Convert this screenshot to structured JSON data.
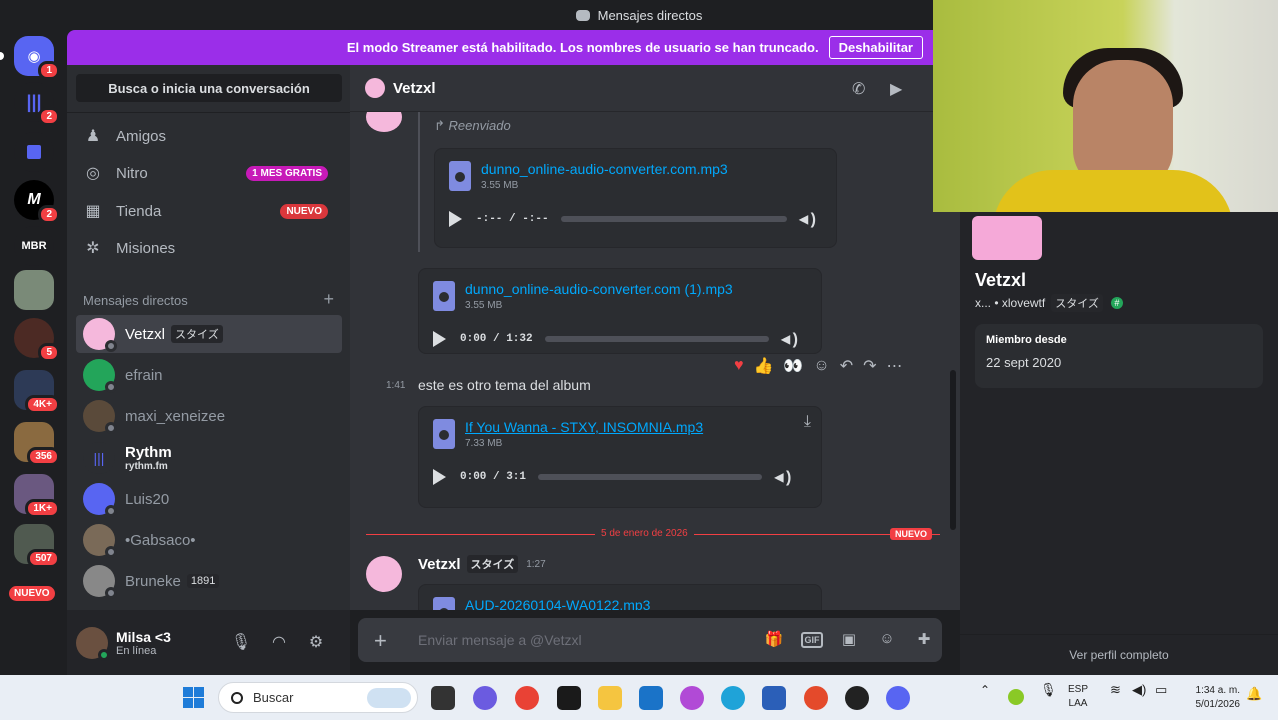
{
  "titlebar": {
    "title": "Mensajes directos"
  },
  "rail": {
    "badges": [
      "1",
      "2",
      "2",
      "5",
      "4K+",
      "356",
      "1K+",
      "507"
    ],
    "mbr_label": "MBR",
    "nuevo": "NUEVO"
  },
  "banner": {
    "text": "El modo Streamer está habilitado. Los nombres de usuario se han truncado.",
    "button": "Deshabilitar"
  },
  "sidebar": {
    "search": "Busca o inicia una conversación",
    "nav": [
      {
        "label": "Amigos"
      },
      {
        "label": "Nitro",
        "tag": "1 MES GRATIS"
      },
      {
        "label": "Tienda",
        "tag": "NUEVO"
      },
      {
        "label": "Misiones"
      }
    ],
    "dm_header": "Mensajes directos",
    "dms": [
      {
        "name": "Vetzxl",
        "tag": "スタイズ"
      },
      {
        "name": "efrain"
      },
      {
        "name": "maxi_xeneizee"
      },
      {
        "name": "Rythm",
        "sub": "rythm.fm"
      },
      {
        "name": "Luis20"
      },
      {
        "name": "•Gabsaco•"
      },
      {
        "name": "Bruneke",
        "tag": "1891"
      }
    ]
  },
  "user": {
    "name": "Milsa <3",
    "status": "En línea"
  },
  "chat": {
    "header": "Vetzxl",
    "forwarded": "Reenviado",
    "attachments": [
      {
        "name": "dunno_online-audio-converter.com.mp3",
        "size": "3.55 MB",
        "time": "-:-- / -:--",
        "progress": 0
      },
      {
        "name": "dunno_online-audio-converter.com (1).mp3",
        "size": "3.55 MB",
        "time": "0:00 / 1:32",
        "progress": 0
      },
      {
        "name": "If You Wanna - STXY, INSOMNIA.mp3",
        "size": "7.33 MB",
        "time": "0:00 / 3:1",
        "progress": 0
      }
    ],
    "message_time": "1:41",
    "message_text": "este es otro tema del album",
    "divider_date": "5 de enero de 2026",
    "new_tag": "NUEVO",
    "next_author": "Vetzxl",
    "next_author_tag": "スタイズ",
    "next_time": "1:27",
    "next_file": "AUD-20260104-WA0122.mp3",
    "composer_placeholder": "Enviar mensaje a @Vetzxl",
    "gif": "GIF"
  },
  "profile": {
    "name": "Vetzxl",
    "handle": "x... • xlovewtf",
    "tag": "スタイズ",
    "member_label": "Miembro desde",
    "member_value": "22 sept 2020",
    "footer": "Ver perfil completo"
  },
  "taskbar": {
    "search": "Buscar",
    "lang": "ESP",
    "lang2": "LAA",
    "time": "1:34 a. m.",
    "date": "5/01/2026"
  },
  "colors": {
    "accent": "#5865f2",
    "streamer": "#9b2ee9",
    "danger": "#f23f43",
    "online": "#23a55a"
  }
}
